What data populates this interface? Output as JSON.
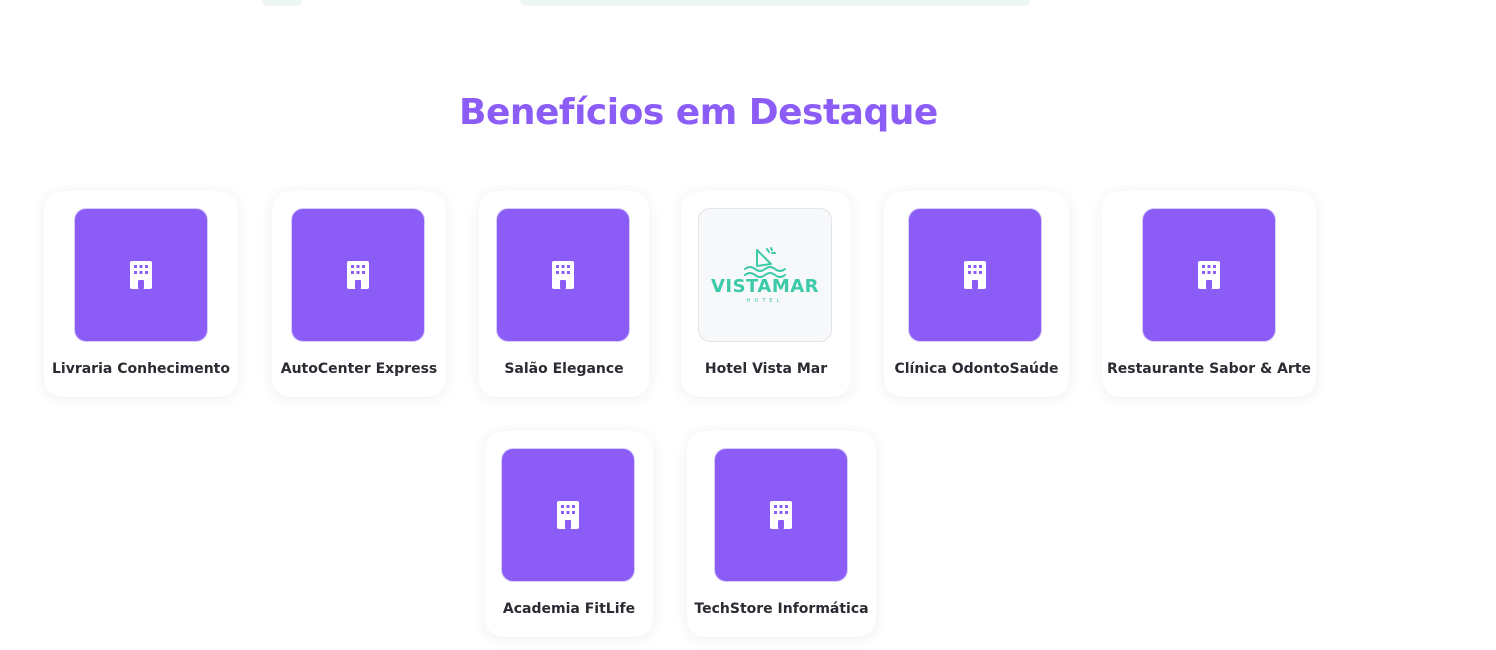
{
  "section": {
    "title": "Benefícios em Destaque"
  },
  "colors": {
    "accent": "#8b5cf6",
    "text": "#2b2b33",
    "logo_teal": "#3ccaa8"
  },
  "partners": [
    {
      "name": "Livraria Conhecimento",
      "logo": "building-icon"
    },
    {
      "name": "AutoCenter Express",
      "logo": "building-icon"
    },
    {
      "name": "Salão Elegance",
      "logo": "building-icon"
    },
    {
      "name": "Hotel Vista Mar",
      "logo": "vistamar-logo",
      "logo_text": "VISTAMAR",
      "logo_subtext": "HOTEL"
    },
    {
      "name": "Clínica OdontoSaúde",
      "logo": "building-icon"
    },
    {
      "name": "Restaurante Sabor & Arte",
      "logo": "building-icon"
    },
    {
      "name": "Academia FitLife",
      "logo": "building-icon"
    },
    {
      "name": "TechStore Informática",
      "logo": "building-icon"
    }
  ]
}
